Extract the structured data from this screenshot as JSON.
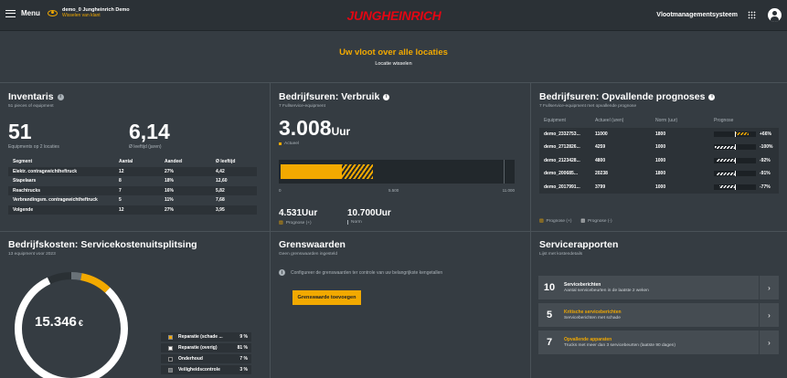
{
  "topbar": {
    "menu_label": "Menu",
    "demo_user": "demo_0 Jungheinrich Demo",
    "demo_switch": "Wisselen van klant",
    "logo": "JUNGHEINRICH",
    "system": "Vlootmanagementsysteem"
  },
  "hero": {
    "title": "Uw vloot over alle locaties",
    "switch": "Locatie wisselen"
  },
  "inventory": {
    "title": "Inventaris",
    "subtitle": "51 pieces of equipment",
    "count": "51",
    "count_label": "Equipments op 2 locaties",
    "age": "6,14",
    "age_label": "Ø leeftijd (jaren)",
    "headers": [
      "Segment",
      "Aantal",
      "Aandeel",
      "Ø leeftijd"
    ],
    "rows": [
      [
        "Elektr. contragewichtheftruck",
        "12",
        "27%",
        "4,42"
      ],
      [
        "Stapelaars",
        "8",
        "18%",
        "12,60"
      ],
      [
        "Reachtrucks",
        "7",
        "16%",
        "5,82"
      ],
      [
        "Verbrandingsm. contragewichtheftruck",
        "5",
        "11%",
        "7,68"
      ],
      [
        "Volgende",
        "12",
        "27%",
        "3,95"
      ]
    ]
  },
  "usage": {
    "title": "Bedrijfsuren: Verbruik",
    "subtitle": "7 Fullservice-equipment",
    "value": "3.008",
    "unit": "Uur",
    "legend_actual": "Actueel",
    "axis": [
      "0",
      "5.500",
      "11.000"
    ],
    "axis_max": 11000,
    "actual": 3008,
    "forecast": 4531,
    "forecast_value": "4.531Uur",
    "forecast_label": "Prognose (+)",
    "norm_value": "10.700Uur",
    "norm_label": "Norm"
  },
  "forecasts": {
    "title": "Bedrijfsuren: Opvallende prognoses",
    "subtitle": "7 Fullservice-equipment met opvallende prognose",
    "headers": [
      "Equipment",
      "Actueel (uren)",
      "Norm (uur)",
      "Prognose"
    ],
    "rows": [
      {
        "eq": "demo_2332753...",
        "actual": "11000",
        "norm": "1800",
        "pct": "+66%",
        "value": 66
      },
      {
        "eq": "demo_2712826...",
        "actual": "4259",
        "norm": "1000",
        "pct": "-100%",
        "value": -100
      },
      {
        "eq": "demo_2123428...",
        "actual": "4800",
        "norm": "1000",
        "pct": "-92%",
        "value": -92
      },
      {
        "eq": "demo_200685...",
        "actual": "20238",
        "norm": "1800",
        "pct": "-91%",
        "value": -91
      },
      {
        "eq": "demo_2017991...",
        "actual": "3799",
        "norm": "1000",
        "pct": "-77%",
        "value": -77
      }
    ],
    "legend_plus": "Prognose (+)",
    "legend_minus": "Prognose (-)"
  },
  "costs": {
    "title": "Bedrijfskosten: Servicekostenuitsplitsing",
    "subtitle": "13 equipment voor 2023",
    "total": "15.346",
    "currency": "€",
    "legend": [
      {
        "label": "Reparatie (schade ...",
        "pct": "9 %",
        "color": "#f2a900",
        "value": 9
      },
      {
        "label": "Reparatie (overig)",
        "pct": "81 %",
        "color": "#ffffff",
        "value": 81
      },
      {
        "label": "Onderhoud",
        "pct": "7 %",
        "color": "#22282c",
        "value": 7
      },
      {
        "label": "Veiligheidscontrole",
        "pct": "3 %",
        "color": "#6a7278",
        "value": 3
      }
    ]
  },
  "limits": {
    "title": "Grenswaarden",
    "subtitle": "Geen grenswaarden ingesteld",
    "info": "Configureer de grenswaarden ter controle van uw belangrijkste kengetallen",
    "button": "Grenswaarde toevoegen"
  },
  "reports": {
    "title": "Servicerapporten",
    "subtitle": "Lijst met kostendetails",
    "items": [
      {
        "n": "10",
        "title": "Serviceberichten",
        "sub": "Aantal servicebeurten in de laatste 2 weken",
        "accent": false
      },
      {
        "n": "5",
        "title": "Kritische serviceberichten",
        "sub": "Serviceberichten met schade",
        "accent": true
      },
      {
        "n": "7",
        "title": "Opvallende apparaten",
        "sub": "Trucks met meer dan 3 servicebeurten (laatste 90 dagen)",
        "accent": true
      }
    ]
  }
}
